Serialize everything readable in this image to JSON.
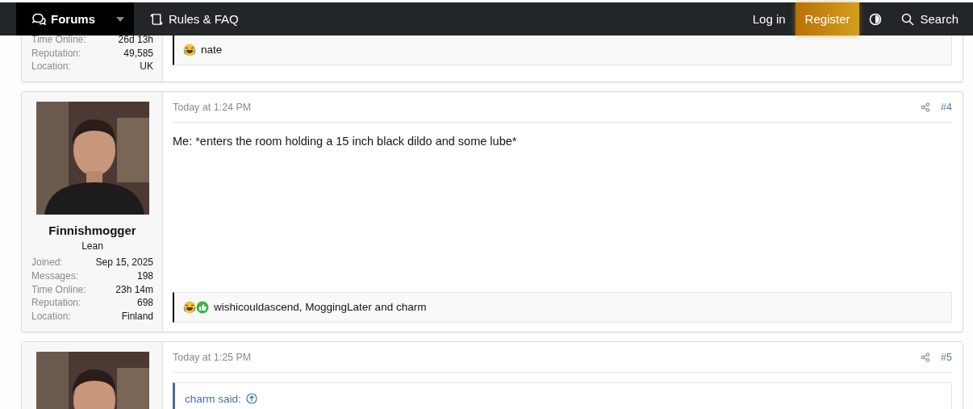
{
  "nav": {
    "items": [
      {
        "label": "Forums",
        "selected": true,
        "dropdown": true
      },
      {
        "label": "Rules & FAQ",
        "selected": false,
        "dropdown": false
      }
    ],
    "login": "Log in",
    "register": "Register",
    "search": "Search"
  },
  "posts": [
    {
      "stats": [
        {
          "label": "Time Online:",
          "value": "26d 13h"
        },
        {
          "label": "Reputation:",
          "value": "49,585"
        },
        {
          "label": "Location:",
          "value": "UK"
        }
      ],
      "reactions": {
        "icons": [
          {
            "kind": "laugh"
          }
        ],
        "text": "nate"
      }
    },
    {
      "username": "Finnishmogger",
      "user_title": "Lean",
      "stats": [
        {
          "label": "Joined:",
          "value": "Sep 15, 2025"
        },
        {
          "label": "Messages:",
          "value": "198"
        },
        {
          "label": "Time Online:",
          "value": "23h 14m"
        },
        {
          "label": "Reputation:",
          "value": "698"
        },
        {
          "label": "Location:",
          "value": "Finland"
        }
      ],
      "time": "Today at 1:24 PM",
      "number": "#4",
      "message": "Me: *enters the room holding a 15 inch black dildo and some lube*",
      "reactions": {
        "icons": [
          {
            "kind": "laugh"
          },
          {
            "kind": "like"
          }
        ],
        "text": "wishicouldascend, MoggingLater and charm"
      }
    },
    {
      "time": "Today at 1:25 PM",
      "number": "#5",
      "quote": {
        "author": "charm said:"
      }
    }
  ]
}
